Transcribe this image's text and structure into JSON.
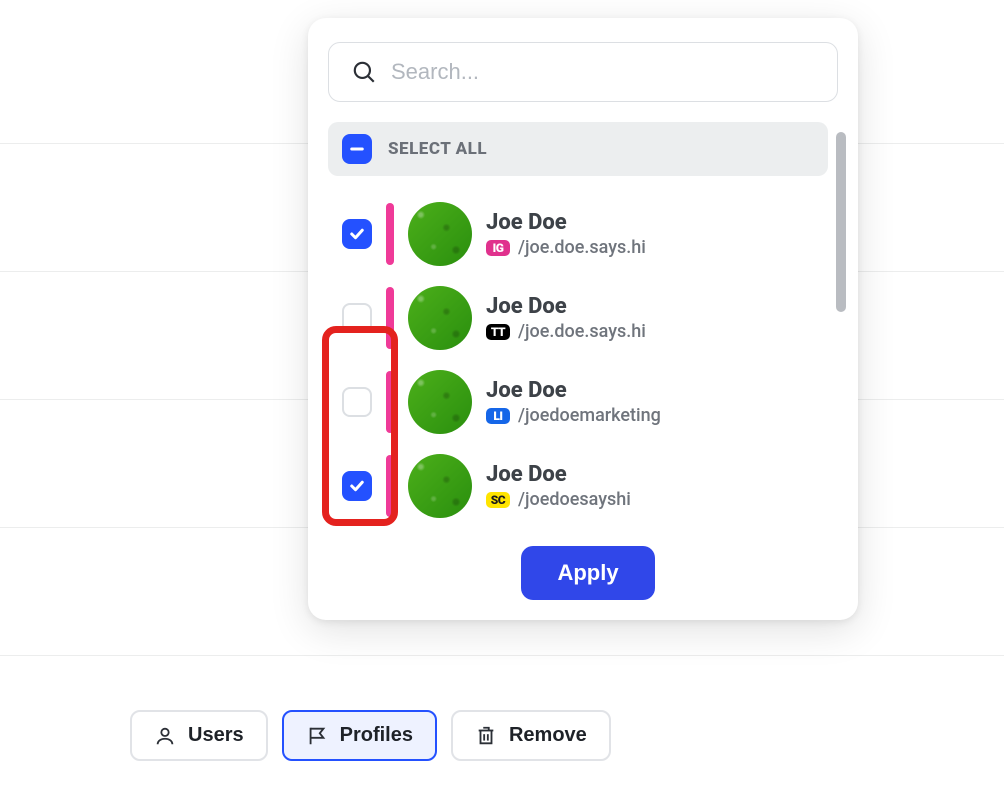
{
  "search": {
    "placeholder": "Search..."
  },
  "selectAll": {
    "label": "SELECT ALL",
    "state": "indeterminate"
  },
  "profiles": [
    {
      "name": "Joe Doe",
      "platform": "IG",
      "handle": "/joe.doe.says.hi",
      "checked": true
    },
    {
      "name": "Joe Doe",
      "platform": "TT",
      "handle": "/joe.doe.says.hi",
      "checked": false
    },
    {
      "name": "Joe Doe",
      "platform": "LI",
      "handle": "/joedoemarketing",
      "checked": false
    },
    {
      "name": "Joe Doe",
      "platform": "SC",
      "handle": "/joedoesayshi",
      "checked": true
    }
  ],
  "buttons": {
    "apply": "Apply"
  },
  "bottomBar": {
    "users": "Users",
    "profiles": "Profiles",
    "remove": "Remove"
  }
}
